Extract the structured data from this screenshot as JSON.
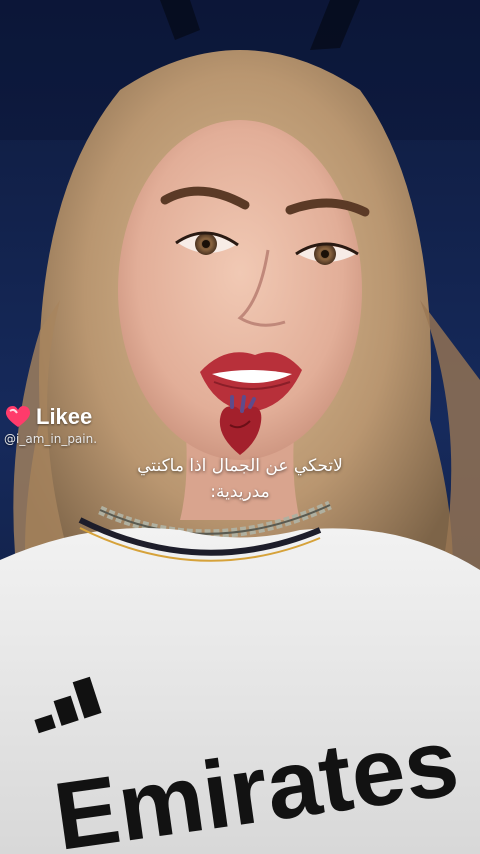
{
  "watermark": {
    "brand": "Likee",
    "handle": "@i_am_in_pain."
  },
  "caption": {
    "line1": "لاتحكي عن الجمال اذا ماكنتي",
    "line2": "مدريدية:"
  },
  "photo": {
    "icons": [
      "anatomical-heart-sticker",
      "adidas-logo"
    ],
    "shirt_text": "Emirates"
  },
  "colors": {
    "background": "#12204a",
    "hair": "#c9a87c",
    "skin": "#e9b9a2",
    "lips": "#b8303a",
    "shirt": "#ececec",
    "likee_heart": "#ff3b6b"
  }
}
